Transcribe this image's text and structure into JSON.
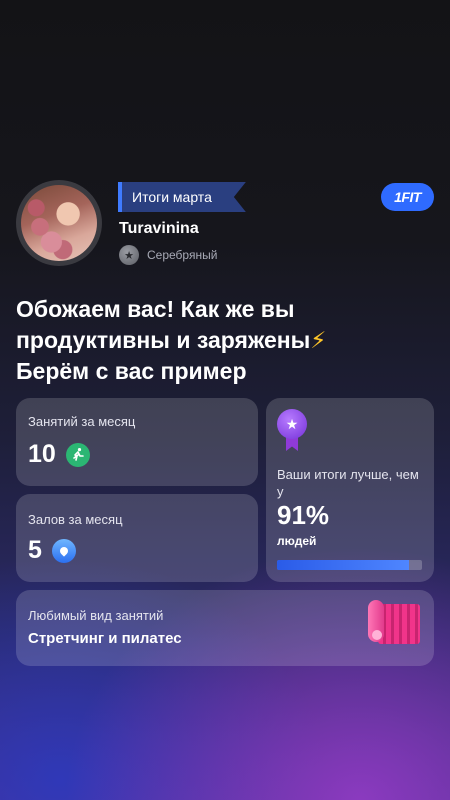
{
  "header": {
    "month_label": "Итоги марта",
    "brand": "1FIT",
    "username": "Turavinina",
    "level": "Серебряный"
  },
  "headline": {
    "line1": "Обожаем вас! Как же вы",
    "line2": "продуктивны и заряжены",
    "line2_emoji": "⚡",
    "line3": "Берём с вас пример"
  },
  "stats": {
    "classes": {
      "label": "Занятий за месяц",
      "value": "10",
      "icon": "running-icon"
    },
    "gyms": {
      "label": "Залов за месяц",
      "value": "5",
      "icon": "map-pin-icon"
    },
    "comparison": {
      "text": "Ваши итоги лучше, чем у",
      "percent": "91%",
      "suffix": "людей",
      "progress": 0.91,
      "icon": "medal-star-icon"
    },
    "favorite": {
      "label": "Любимый вид занятий",
      "value": "Стретчинг и пилатес",
      "icon": "yoga-mat-icon"
    }
  },
  "colors": {
    "accent": "#2f6bff",
    "run_icon": "#2bb673",
    "medal": "#8f3ad8",
    "mat": "#f1348a"
  }
}
